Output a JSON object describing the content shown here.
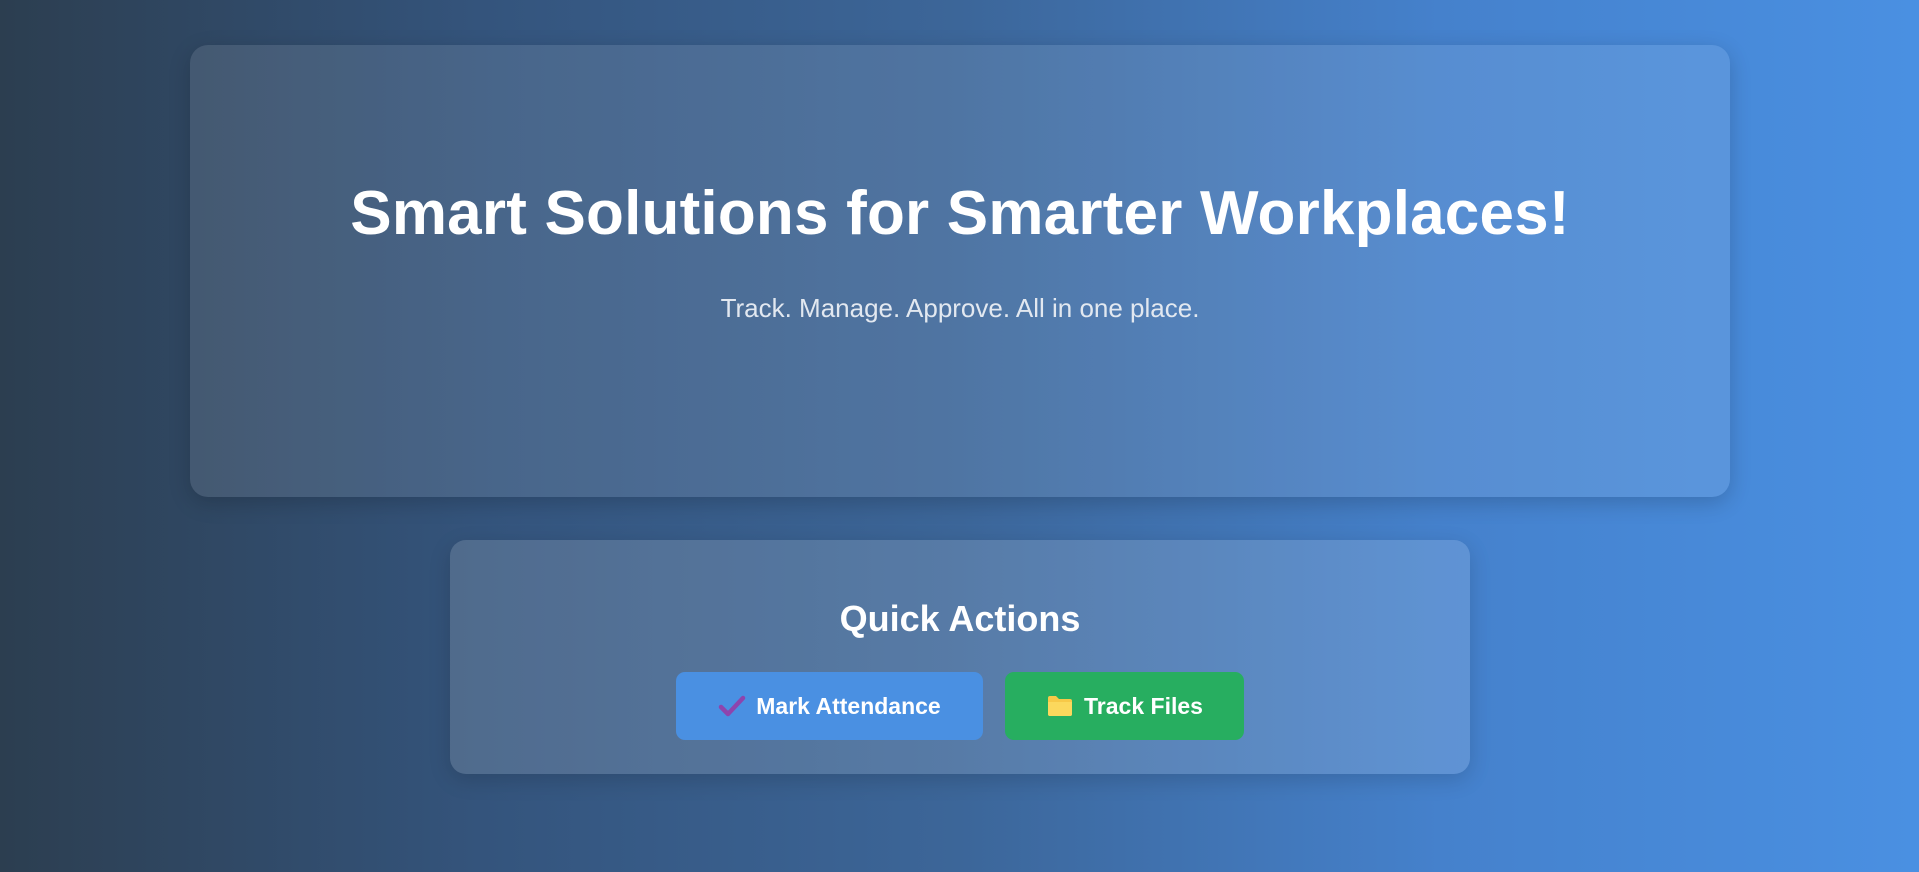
{
  "hero": {
    "title": "Smart Solutions for Smarter Workplaces!",
    "subtitle": "Track. Manage. Approve. All in one place."
  },
  "quick_actions": {
    "heading": "Quick Actions",
    "buttons": [
      {
        "label": "Mark Attendance",
        "icon": "check-icon",
        "color": "#4a90e2",
        "icon_color": "#8e44ad"
      },
      {
        "label": "Track Files",
        "icon": "folder-icon",
        "color": "#27ae60",
        "icon_color": "#f7c948"
      }
    ]
  },
  "colors": {
    "gradient_start": "#2c3e50",
    "gradient_end": "#4a90e2"
  }
}
